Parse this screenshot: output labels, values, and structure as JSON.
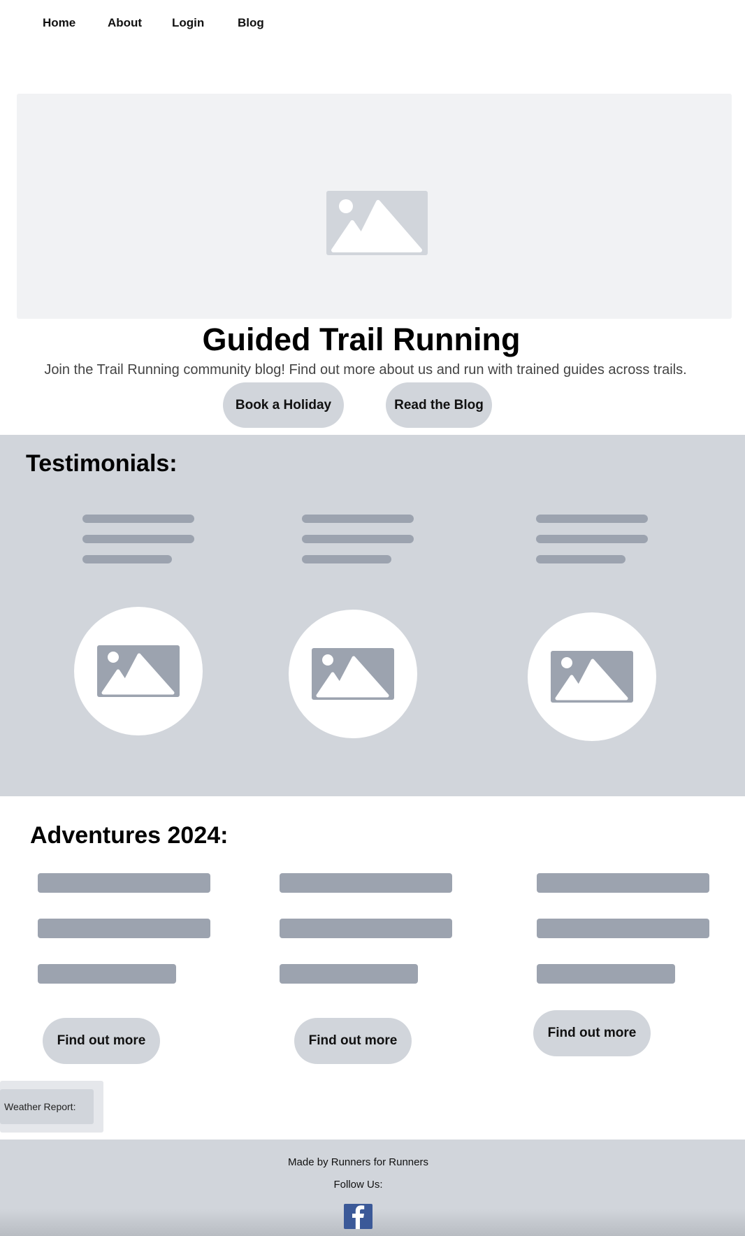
{
  "nav": {
    "items": [
      "Home",
      "About",
      "Login",
      "Blog"
    ]
  },
  "hero": {
    "image_icon": "image-placeholder-icon",
    "title": "Guided Trail Running",
    "description": "Join the Trail Running community blog! Find out more about us and run with trained guides across trails.",
    "buttons": [
      "Book a Holiday",
      "Read the Blog"
    ]
  },
  "testimonials": {
    "title": "Testimonials:",
    "avatar_icon": "image-placeholder-icon"
  },
  "adventures": {
    "title": "Adventures 2024:",
    "button_label": "Find out more"
  },
  "weather": {
    "label": "Weather Report:"
  },
  "footer": {
    "made_by": "Made by Runners for Runners",
    "follow_us": "Follow Us:",
    "social_icon": "facebook-icon"
  },
  "colors": {
    "section_bg": "#d1d5db",
    "hero_bg": "#f1f2f4",
    "placeholder_dark": "#9ca3af",
    "facebook_blue": "#3b5998"
  }
}
